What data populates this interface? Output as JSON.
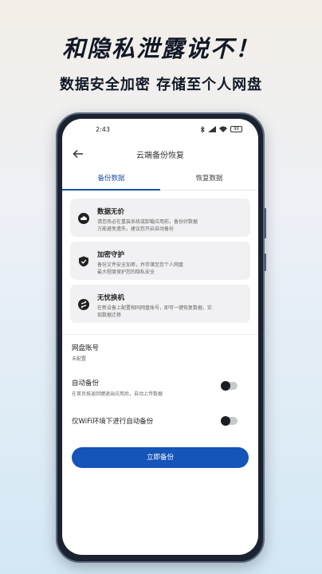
{
  "promo": {
    "headline": "和隐私泄露说不！",
    "subline": "数据安全加密  存储至个人网盘"
  },
  "status_bar": {
    "time": "2:43",
    "battery": "99"
  },
  "nav": {
    "title": "云端备份恢复"
  },
  "tabs": [
    {
      "label": "备份数据",
      "active": true
    },
    {
      "label": "恢复数据",
      "active": false
    }
  ],
  "cards": [
    {
      "icon": "cloud-icon",
      "title": "数据无价",
      "desc_line1": "请您务必在重装系统或卸载应用前，备份好数据",
      "desc_line2": "方能避免遗失，建议您开启自动备份"
    },
    {
      "icon": "shield-check-icon",
      "title": "加密守护",
      "desc_line1": "备份文件安全加密，并存储至您个人网盘",
      "desc_line2": "最大程度保护您的隐私安全"
    },
    {
      "icon": "transfer-icon",
      "title": "无忧换机",
      "desc_line1": "在新设备上配置相同网盘账号，即可一键恢复数据，实",
      "desc_line2": "现数据迁移"
    }
  ],
  "settings": {
    "netdisk": {
      "label": "网盘账号",
      "value": "未配置"
    },
    "auto_backup": {
      "label": "自动备份",
      "desc": "在首页按返回键退出应用后，自动上传数据",
      "enabled": false
    },
    "wifi_only": {
      "label": "仅WiFi环境下进行自动备份",
      "enabled": false
    }
  },
  "primary_button": {
    "label": "立即备份"
  },
  "colors": {
    "accent": "#1554b8",
    "tab_active": "#1f4fa8",
    "card_bg": "#f1f1f3"
  }
}
